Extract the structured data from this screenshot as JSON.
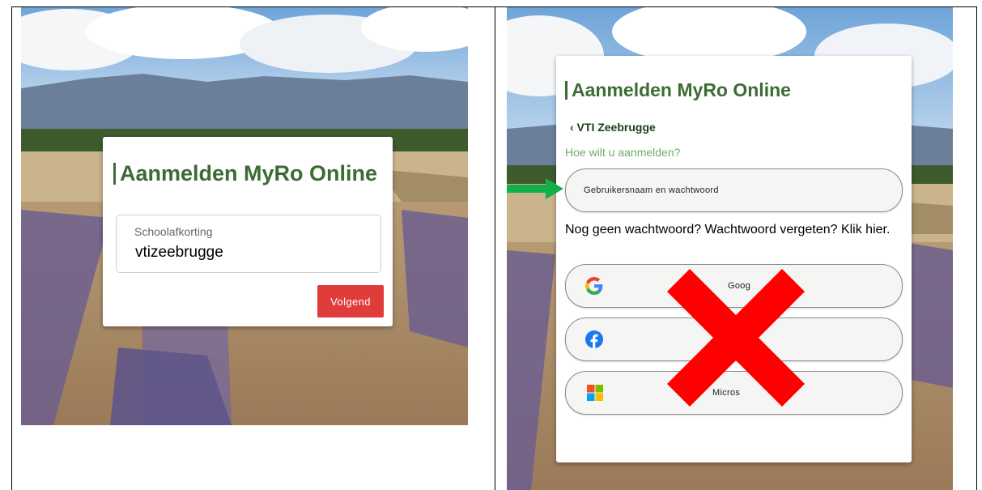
{
  "left_panel": {
    "title": "Aanmelden MyRo Online",
    "school_field": {
      "label": "Schoolafkorting",
      "value": "vtizeebrugge"
    },
    "next_button": "Volgend"
  },
  "right_panel": {
    "title": "Aanmelden MyRo Online",
    "back_link": "‹ VTI Zeebrugge",
    "question": "Hoe wilt u aanmelden?",
    "username_option": "Gebruikersnaam en wachtwoord",
    "help_text": "Nog geen wachtwoord? Wachtwoord vergeten? Klik hier.",
    "providers": [
      {
        "name": "Google",
        "visible_label": "Goog",
        "icon": "google-icon"
      },
      {
        "name": "Facebook",
        "visible_label": "",
        "icon": "facebook-icon"
      },
      {
        "name": "Microsoft",
        "visible_label": "Micros",
        "icon": "microsoft-icon"
      }
    ]
  },
  "annotations": {
    "arrow": "green-arrow-icon",
    "cross": "red-x-icon"
  },
  "colors": {
    "title_green": "#3d6b35",
    "question_green": "#6fae6a",
    "button_red": "#e03c3c",
    "arrow_green": "#12b04a",
    "cross_red": "#ff0000"
  }
}
